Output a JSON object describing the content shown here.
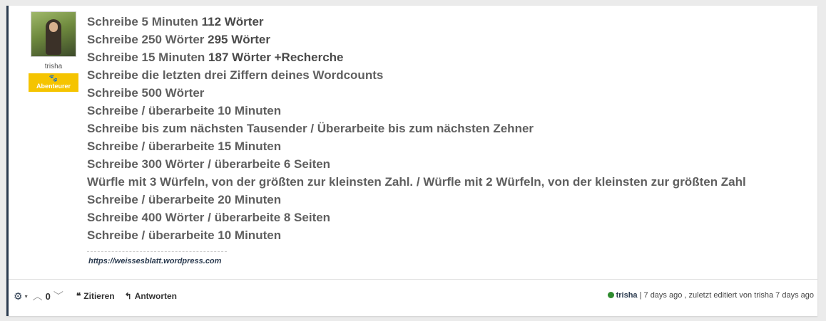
{
  "author": {
    "username": "trisha",
    "rank_label": "Abenteurer",
    "rank_icon": "paw-icon",
    "rank_color": "#f5c400"
  },
  "post": {
    "lines": [
      {
        "text": "Schreibe 5 Minuten ",
        "strong": "112 Wörter"
      },
      {
        "text": "Schreibe 250 Wörter ",
        "strong": "295 Wörter"
      },
      {
        "text": "Schreibe 15 Minuten ",
        "strong": "187 Wörter +Recherche"
      },
      {
        "text": "Schreibe die letzten drei Ziffern deines Wordcounts",
        "strong": ""
      },
      {
        "text": "Schreibe 500 Wörter",
        "strong": ""
      },
      {
        "text": "Schreibe / überarbeite 10 Minuten",
        "strong": ""
      },
      {
        "text": "Schreibe bis zum nächsten Tausender / Überarbeite bis zum nächsten Zehner",
        "strong": ""
      },
      {
        "text": "Schreibe / überarbeite 15 Minuten",
        "strong": ""
      },
      {
        "text": "Schreibe 300 Wörter / überarbeite 6 Seiten",
        "strong": ""
      },
      {
        "text": "Würfle mit 3 Würfeln, von der größten zur kleinsten Zahl. / Würfle mit 2 Würfeln, von der kleinsten zur größten Zahl",
        "strong": ""
      },
      {
        "text": "Schreibe / überarbeite 20 Minuten",
        "strong": ""
      },
      {
        "text": "Schreibe 400 Wörter / überarbeite 8 Seiten",
        "strong": ""
      },
      {
        "text": "Schreibe / überarbeite 10 Minuten",
        "strong": ""
      }
    ],
    "signature": "https://weissesblatt.wordpress.com"
  },
  "footer": {
    "vote_count": "0",
    "quote_label": "Zitieren",
    "reply_label": "Antworten",
    "online_user": "trisha",
    "meta_text": " | 7 days ago , zuletzt editiert von trisha 7 days ago",
    "online_color": "#2e8b2e"
  }
}
